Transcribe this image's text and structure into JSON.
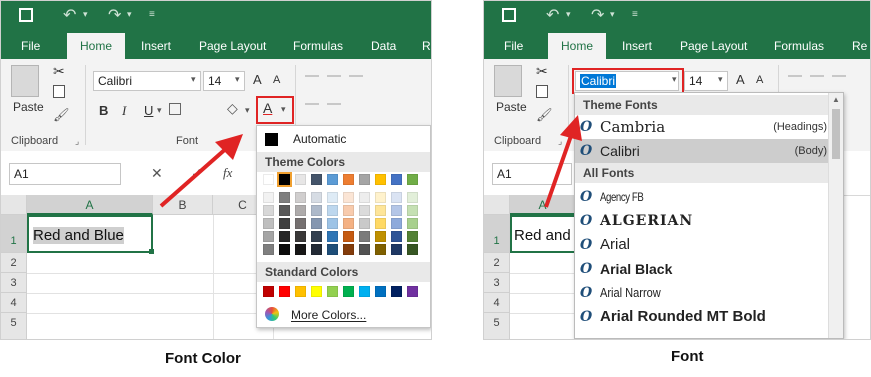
{
  "left": {
    "tabs": [
      "File",
      "Home",
      "Insert",
      "Page Layout",
      "Formulas",
      "Data",
      "Re"
    ],
    "paste_label": "Paste",
    "clipboard_label": "Clipboard",
    "font_group_label": "Font",
    "font_name": "Calibri",
    "font_size": "14",
    "bold": "B",
    "italic": "I",
    "underline": "U",
    "grow_font": "A",
    "shrink_font": "A",
    "font_color_button": "A",
    "namebox": "A1",
    "fx": "fx",
    "columns": [
      "A",
      "B",
      "C"
    ],
    "rows": [
      "1",
      "2",
      "3",
      "4",
      "5"
    ],
    "cell_a1": "Red and Blue",
    "color_menu": {
      "automatic": "Automatic",
      "theme_header": "Theme Colors",
      "standard_header": "Standard Colors",
      "more_colors": "More Colors...",
      "theme_top": [
        "#ffffff",
        "#000000",
        "#e7e6e6",
        "#44546a",
        "#4472c4",
        "#ed7d31",
        "#a5a5a5",
        "#ffc000",
        "#5b9bd5",
        "#70ad47"
      ],
      "theme_top_fixed": [
        "#ffffff",
        "#000000",
        "#e7e6e6",
        "#44546a",
        "#5b9bd5",
        "#ed7d31",
        "#a5a5a5",
        "#ffc000",
        "#4472c4",
        "#70ad47"
      ],
      "theme_shades": [
        [
          "#f2f2f2",
          "#7f7f7f",
          "#d0cece",
          "#d6dce4",
          "#deebf6",
          "#fbe5d5",
          "#ededed",
          "#fff2cc",
          "#dae3f3",
          "#e2efd9"
        ],
        [
          "#d8d8d8",
          "#595959",
          "#aeabab",
          "#adb9ca",
          "#bdd7ee",
          "#f8cbad",
          "#dbdbdb",
          "#fee599",
          "#b4c6e7",
          "#c5e0b3"
        ],
        [
          "#bfbfbf",
          "#3f3f3f",
          "#757070",
          "#8496b0",
          "#9dc3e6",
          "#f4b183",
          "#c9c9c9",
          "#ffd965",
          "#8eaadb",
          "#a8d08d"
        ],
        [
          "#a5a5a5",
          "#262626",
          "#3a3838",
          "#323f4f",
          "#2e75b5",
          "#c55a11",
          "#7b7b7b",
          "#bf9000",
          "#2f5496",
          "#538135"
        ],
        [
          "#7f7f7f",
          "#0c0c0c",
          "#171616",
          "#222a35",
          "#1e4e79",
          "#833c0b",
          "#525252",
          "#7f6000",
          "#1f3864",
          "#375623"
        ]
      ],
      "standard": [
        "#c00000",
        "#ff0000",
        "#ffc000",
        "#ffff00",
        "#92d050",
        "#00b050",
        "#00b0f0",
        "#0070c0",
        "#002060",
        "#7030a0"
      ]
    },
    "caption": "Font Color"
  },
  "right": {
    "tabs": [
      "File",
      "Home",
      "Insert",
      "Page Layout",
      "Formulas",
      "Data",
      "Re"
    ],
    "paste_label": "Paste",
    "clipboard_label": "Clipboard",
    "font_name": "Calibri",
    "font_size": "14",
    "namebox": "A1",
    "columns": [
      "A"
    ],
    "rows": [
      "1",
      "2",
      "3",
      "4",
      "5"
    ],
    "cell_a1": "Red and",
    "font_menu": {
      "theme_header": "Theme Fonts",
      "all_header": "All Fonts",
      "theme_fonts": [
        {
          "name": "Cambria",
          "tag": "(Headings)"
        },
        {
          "name": "Calibri",
          "tag": "(Body)"
        }
      ],
      "all_fonts": [
        "Agency FB",
        "ALGERIAN",
        "Arial",
        "Arial Black",
        "Arial Narrow",
        "Arial Rounded MT Bold"
      ]
    },
    "caption": "Font"
  },
  "colors": {
    "excel_green": "#217346",
    "highlight_red": "#e02424"
  }
}
